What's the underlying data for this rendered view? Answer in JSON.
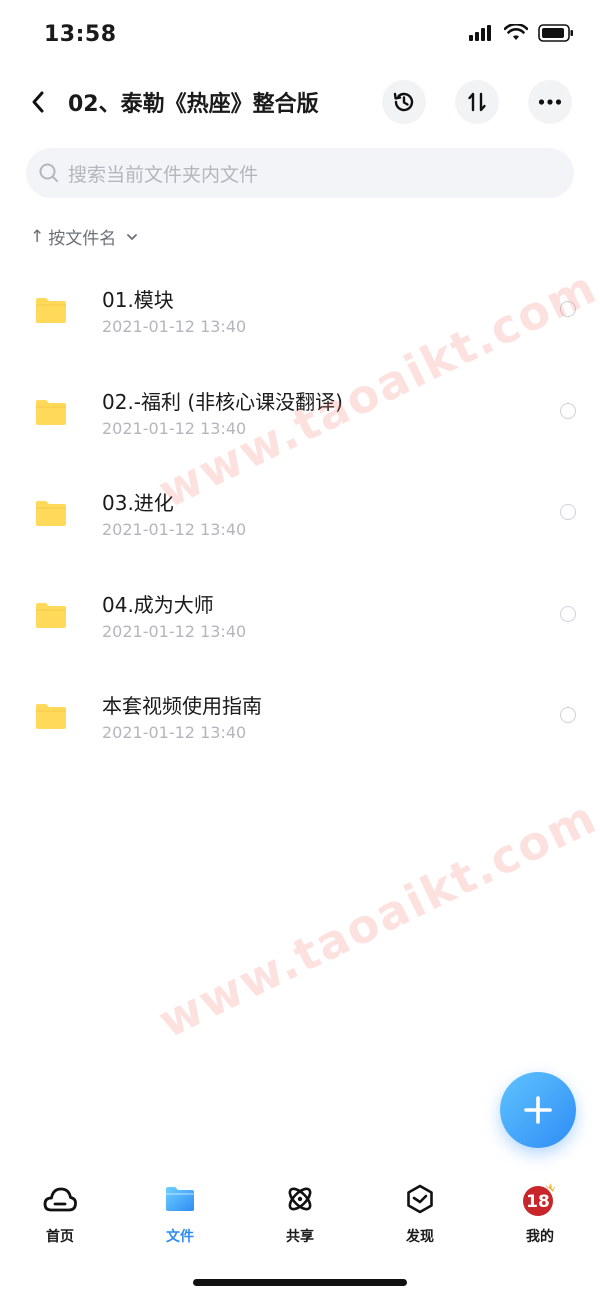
{
  "status_bar": {
    "time": "13:58"
  },
  "nav": {
    "title": "02、泰勒《热座》整合版",
    "icons": [
      "back-icon",
      "history-icon",
      "sort-icon",
      "more-icon"
    ]
  },
  "search": {
    "placeholder": "搜索当前文件夹内文件"
  },
  "sort": {
    "label": "按文件名"
  },
  "files": [
    {
      "name": "01.模块",
      "date": "2021-01-12 13:40"
    },
    {
      "name": "02.-福利 (非核心课没翻译)",
      "date": "2021-01-12 13:40"
    },
    {
      "name": "03.进化",
      "date": "2021-01-12 13:40"
    },
    {
      "name": "04.成为大师",
      "date": "2021-01-12 13:40"
    },
    {
      "name": "本套视频使用指南",
      "date": "2021-01-12 13:40"
    }
  ],
  "watermark": "www.taoaikt.com",
  "tabs": [
    {
      "label": "首页",
      "icon": "cloud-icon"
    },
    {
      "label": "文件",
      "icon": "folder-icon"
    },
    {
      "label": "共享",
      "icon": "share-orbit-icon"
    },
    {
      "label": "发现",
      "icon": "discover-icon"
    },
    {
      "label": "我的",
      "icon": "avatar"
    }
  ],
  "colors": {
    "accent": "#2f8cf5",
    "folder": "#ffd95a",
    "watermark": "#f0786e"
  }
}
